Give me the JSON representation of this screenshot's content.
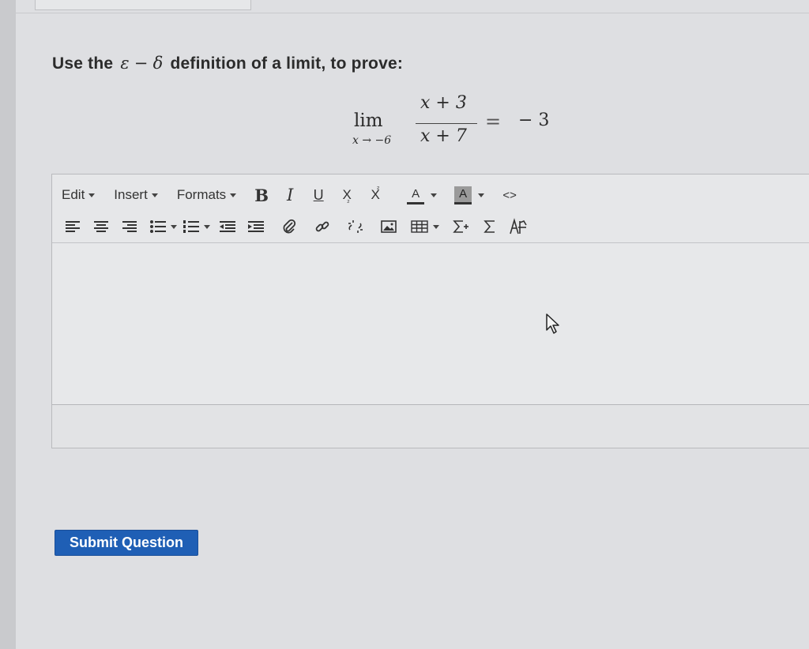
{
  "question": {
    "prefix": "Use the",
    "epsilon": "ε",
    "dash": "−",
    "delta": "δ",
    "suffix": "definition of a limit, to prove:"
  },
  "formula": {
    "lim": "lim",
    "lim_sub": "x → −6",
    "numerator": "x + 3",
    "denominator": "x + 7",
    "equals": "=",
    "rhs": "− 3"
  },
  "editor": {
    "menus": [
      {
        "label": "Edit"
      },
      {
        "label": "Insert"
      },
      {
        "label": "Formats"
      }
    ],
    "format_buttons": {
      "bold": "B",
      "italic": "I",
      "underline": "U",
      "subscript": "X",
      "superscript": "X",
      "font_color": "A",
      "background_color": "A",
      "source_code": "<>"
    },
    "row2_icons": [
      "align-left-icon",
      "align-center-icon",
      "align-right-icon",
      "bullet-list-icon",
      "numbered-list-icon",
      "outdent-icon",
      "indent-icon",
      "attachment-icon",
      "link-icon",
      "unlink-icon",
      "image-icon",
      "table-icon",
      "equation-editor-icon",
      "sigma-icon",
      "chemistry-icon"
    ],
    "content": ""
  },
  "submit": {
    "label": "Submit Question"
  },
  "colors": {
    "submit": "#1f5fb5",
    "background": "#dedfe2"
  }
}
